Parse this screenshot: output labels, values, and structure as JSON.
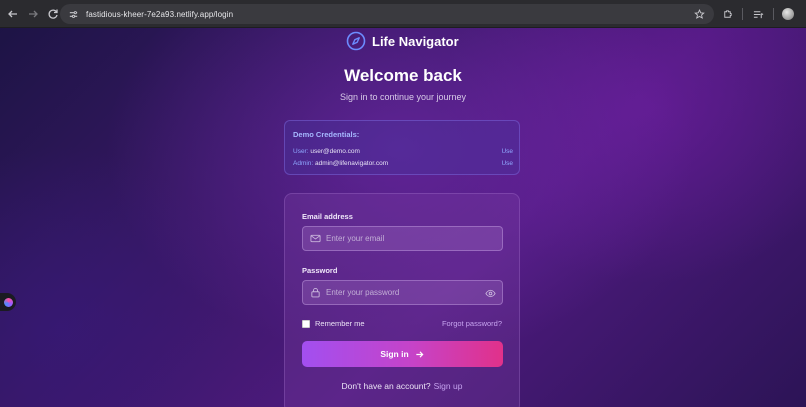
{
  "browser": {
    "url": "fastidious-kheer-7e2a93.netlify.app/login"
  },
  "brand": {
    "name": "Life Navigator"
  },
  "header": {
    "title": "Welcome back",
    "subtitle": "Sign in to continue your journey"
  },
  "demo": {
    "title": "Demo Credentials:",
    "user_label": "User:",
    "user_value": "user@demo.com",
    "admin_label": "Admin:",
    "admin_value": "admin@lifenavigator.com",
    "use_label": "Use"
  },
  "form": {
    "email_label": "Email address",
    "email_placeholder": "Enter your email",
    "email_value": "",
    "password_label": "Password",
    "password_placeholder": "Enter your password",
    "password_value": "",
    "remember_label": "Remember me",
    "remember_checked": false,
    "forgot_label": "Forgot password?",
    "submit_label": "Sign in",
    "signup_prompt": "Don't have an account?",
    "signup_link": "Sign up"
  },
  "colors": {
    "accent_start": "#a24ff0",
    "accent_end": "#e1318a",
    "link": "#c6a3ef",
    "demo_accent": "#8fa8ff"
  },
  "icons": {
    "brand": "compass-icon",
    "email": "mail-icon",
    "password": "lock-icon",
    "reveal": "eye-icon",
    "submit": "arrow-right-icon"
  }
}
